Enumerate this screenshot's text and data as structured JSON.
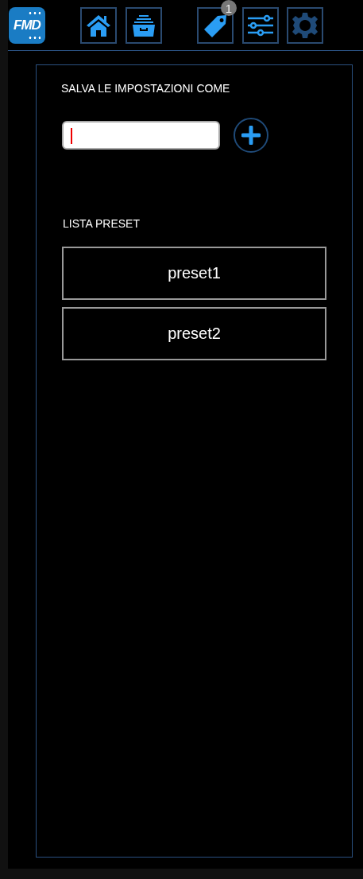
{
  "app": {
    "logo": "FMD"
  },
  "nav": [
    {
      "kind": "home",
      "selected": false
    },
    {
      "kind": "archive",
      "selected": false
    },
    {
      "kind": "tag",
      "selected": false,
      "badge": "1"
    },
    {
      "kind": "sliders",
      "selected": false
    },
    {
      "kind": "gear",
      "selected": true
    }
  ],
  "save": {
    "label": "SALVA LE IMPOSTAZIONI COME",
    "field": {
      "focused": true
    }
  },
  "presets": {
    "title": "LISTA PRESET",
    "items": [
      {
        "label": "preset1"
      },
      {
        "label": "preset2"
      }
    ]
  }
}
